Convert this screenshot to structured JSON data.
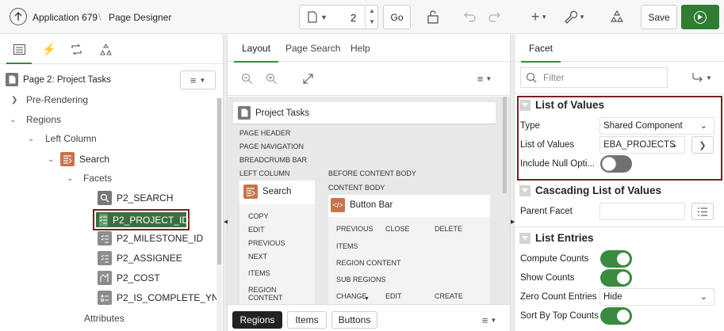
{
  "header": {
    "app_name": "Application 679",
    "separator": "\\",
    "page_designer": "Page Designer",
    "page_number": "2",
    "go_label": "Go",
    "save_label": "Save"
  },
  "left_panel": {
    "page_title": "Page 2: Project Tasks",
    "tree": {
      "pre_rendering": "Pre-Rendering",
      "regions": "Regions",
      "left_column": "Left Column",
      "search": "Search",
      "facets": "Facets",
      "items": [
        "P2_SEARCH",
        "P2_PROJECT_ID",
        "P2_MILESTONE_ID",
        "P2_ASSIGNEE",
        "P2_COST",
        "P2_IS_COMPLETE_YN"
      ],
      "attributes": "Attributes"
    }
  },
  "middle_panel": {
    "tabs": [
      "Layout",
      "Page Search",
      "Help"
    ],
    "page_title": "Project Tasks",
    "positions": [
      "PAGE HEADER",
      "PAGE NAVIGATION",
      "BREADCRUMB BAR",
      "LEFT COLUMN"
    ],
    "before_content_body": "BEFORE CONTENT BODY",
    "content_body": "CONTENT BODY",
    "search_region": "Search",
    "search_slots": [
      "COPY",
      "EDIT",
      "PREVIOUS",
      "NEXT",
      "ITEMS",
      "REGION CONTENT"
    ],
    "button_bar": "Button Bar",
    "button_bar_slots": [
      [
        "PREVIOUS",
        "CLOSE",
        "DELETE"
      ],
      [
        "ITEMS",
        "",
        ""
      ],
      [
        "REGION CONTENT",
        "",
        ""
      ],
      [
        "SUB REGIONS",
        "",
        ""
      ],
      [
        "CHANGE",
        "EDIT",
        "CREATE"
      ]
    ],
    "bottom_tabs": [
      "Regions",
      "Items",
      "Buttons"
    ]
  },
  "right_panel": {
    "tab": "Facet",
    "filter_placeholder": "Filter",
    "list_of_values": {
      "title": "List of Values",
      "type_label": "Type",
      "type_value": "Shared Component",
      "lov_label": "List of Values",
      "lov_value": "EBA_PROJECTS",
      "include_null_label": "Include Null Opti...",
      "include_null": false
    },
    "cascading": {
      "title": "Cascading List of Values",
      "parent_facet_label": "Parent Facet",
      "parent_facet_value": ""
    },
    "list_entries": {
      "title": "List Entries",
      "compute_counts_label": "Compute Counts",
      "compute_counts": true,
      "show_counts_label": "Show Counts",
      "show_counts": true,
      "zero_count_label": "Zero Count Entries",
      "zero_count_value": "Hide",
      "sort_by_top_label": "Sort By Top Counts",
      "sort_by_top": true
    }
  },
  "colors": {
    "accent": "#3a8a3f",
    "run_button": "#2e7d32",
    "highlight_border": "#7a1f23",
    "toggle_on": "#3a8a3f",
    "toggle_off": "#707070",
    "region_icon": "#c8734e"
  }
}
